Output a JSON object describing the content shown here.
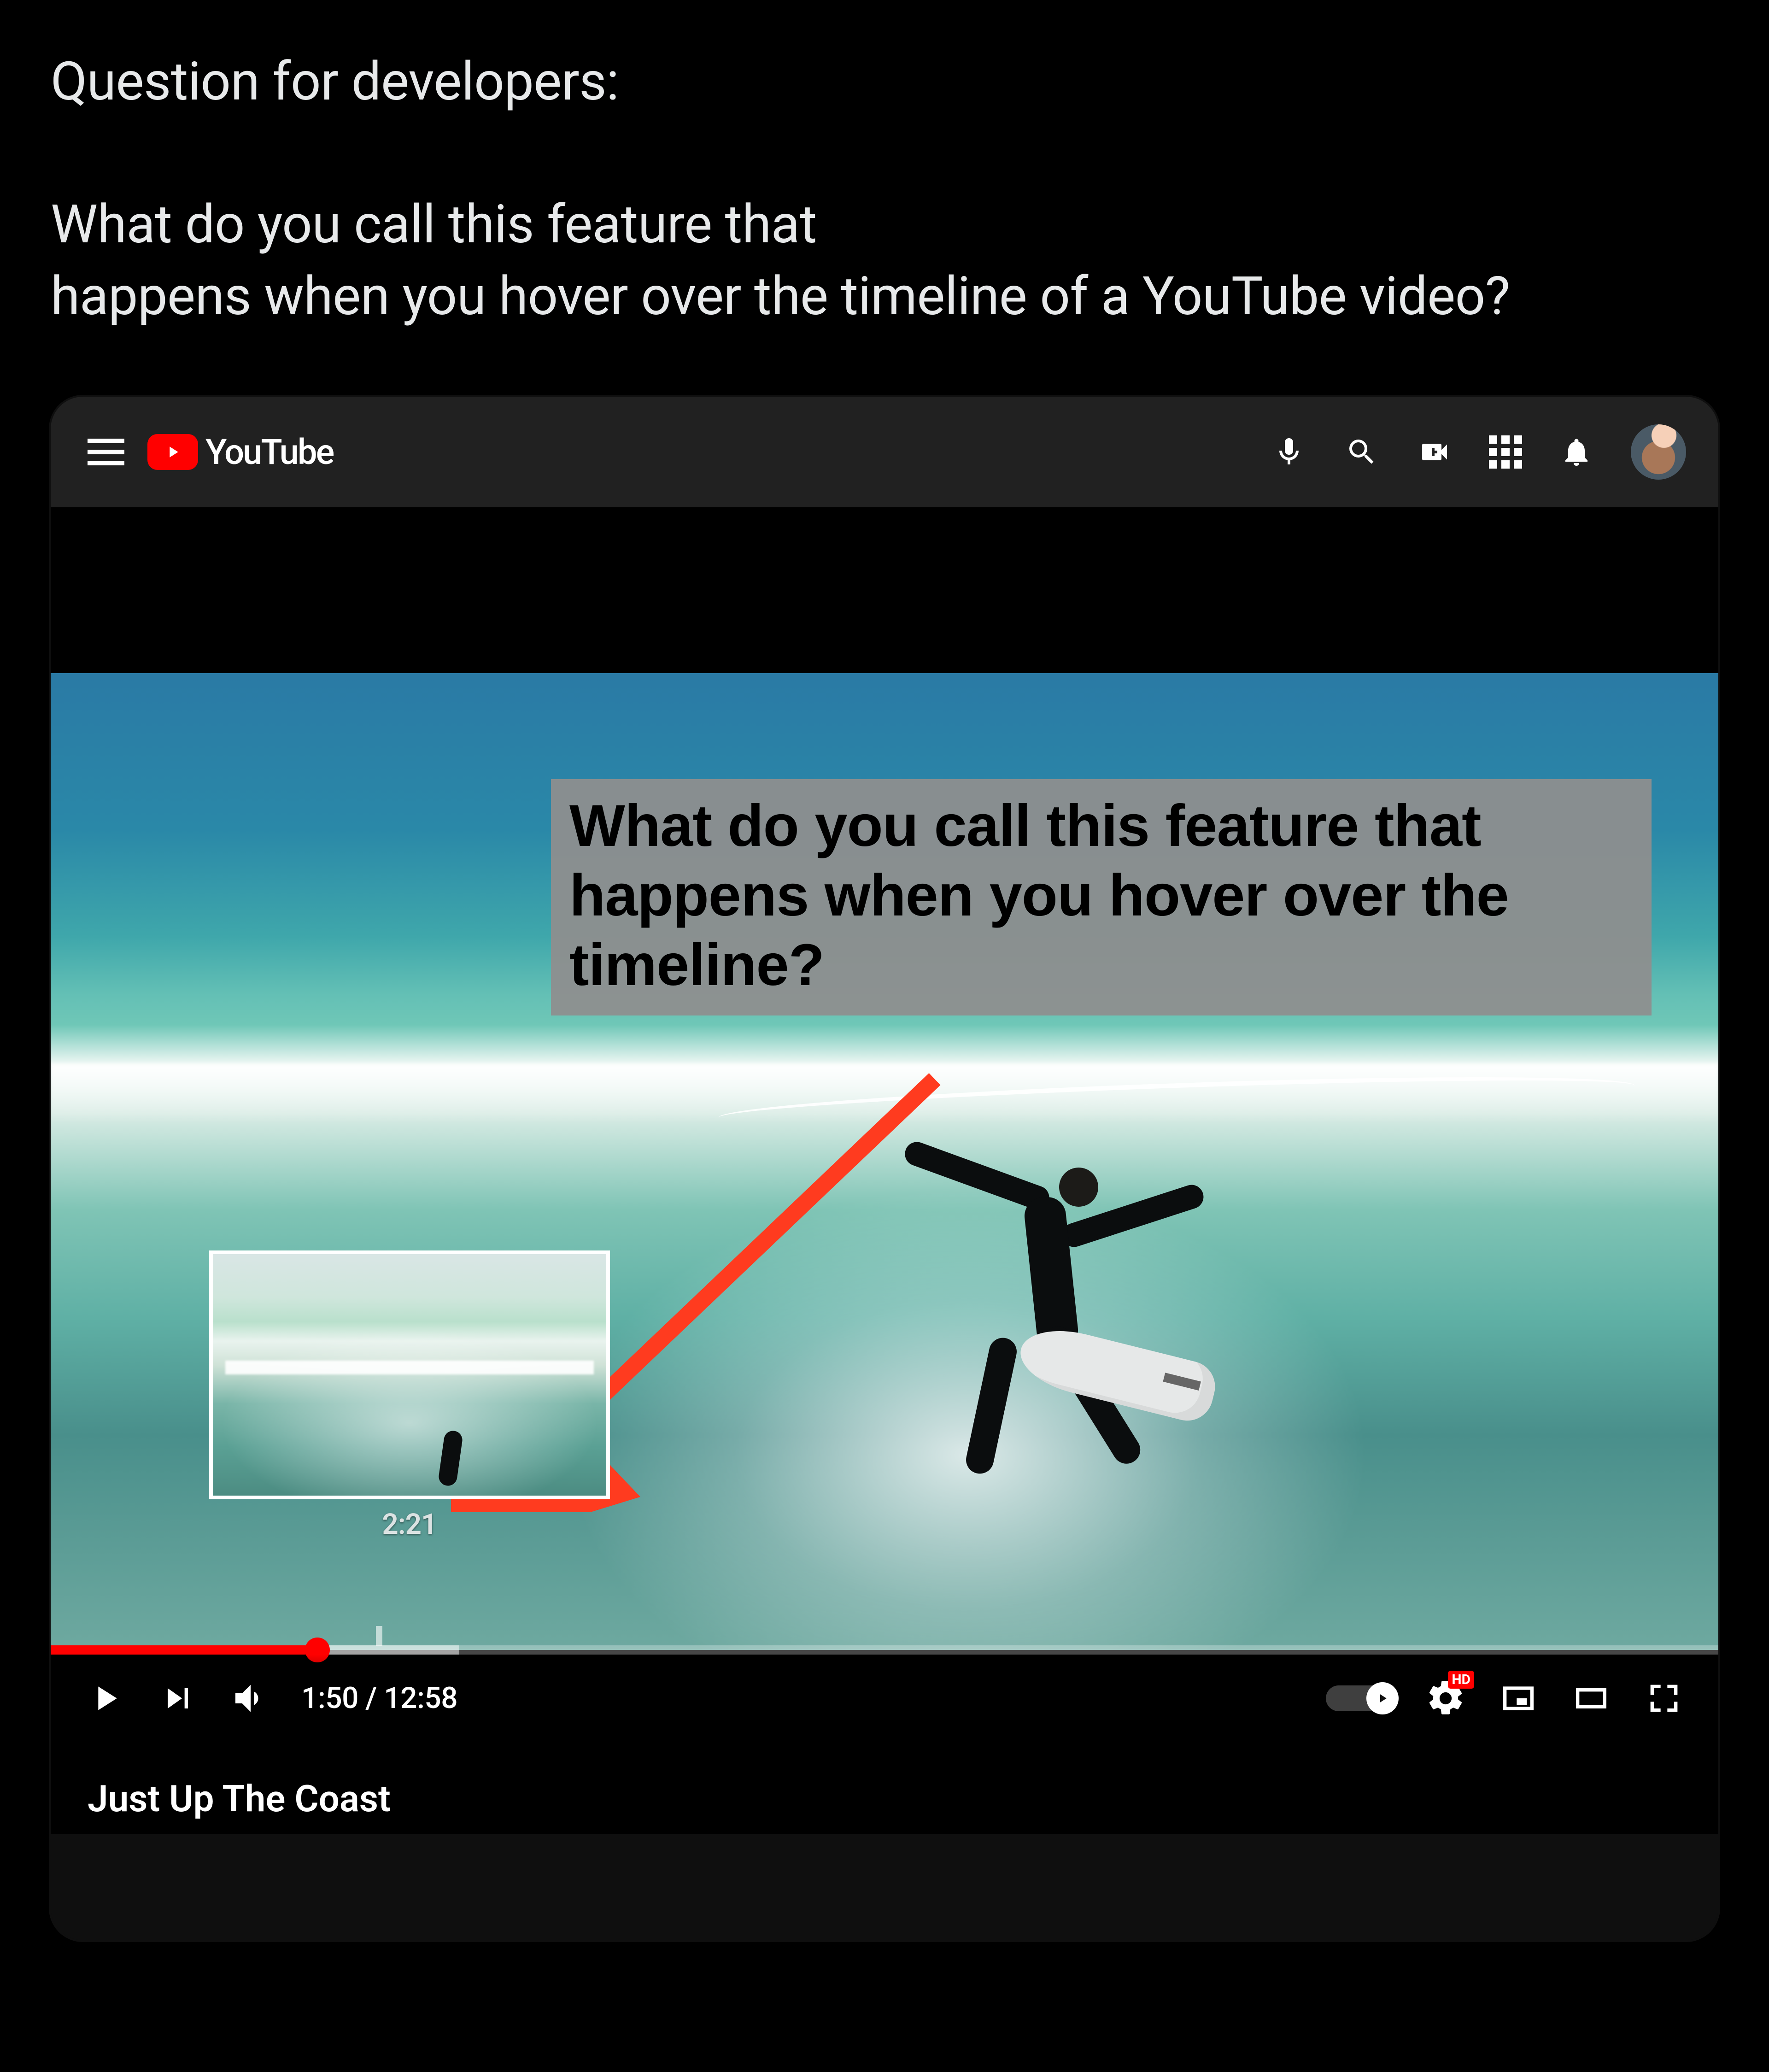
{
  "post": {
    "line1": "Question for developers:",
    "line2": "What do you call this feature that",
    "line3": "happens when you hover over the timeline of a YouTube video?"
  },
  "youtube": {
    "brand": "YouTube",
    "video_title": "Just Up The Coast"
  },
  "overlay": {
    "text": "What do you call this feature that happens when you hover over the timeline?"
  },
  "player": {
    "hover_time": "2:21",
    "current_time": "1:50",
    "duration": "12:58",
    "time_display": "1:50 / 12:58",
    "hd_badge": "HD"
  }
}
